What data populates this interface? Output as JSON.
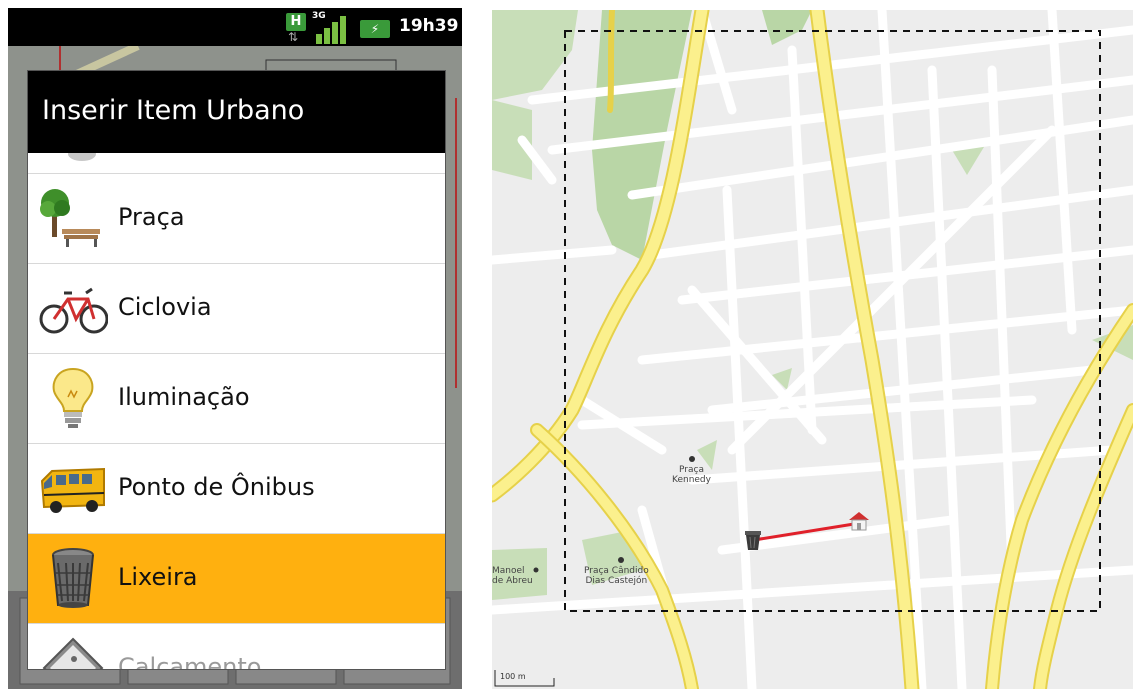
{
  "status_bar": {
    "network_h": "H",
    "network_3g": "3G",
    "time": "19h39"
  },
  "dialog": {
    "title": "Inserir Item Urbano",
    "items": [
      {
        "label": "Praça",
        "icon": "park-icon"
      },
      {
        "label": "Ciclovia",
        "icon": "bicycle-icon"
      },
      {
        "label": "Iluminação",
        "icon": "lightbulb-icon"
      },
      {
        "label": "Ponto de Ônibus",
        "icon": "bus-icon"
      },
      {
        "label": "Lixeira",
        "icon": "trash-bin-icon",
        "selected": true
      },
      {
        "label": "Calçamento",
        "icon": "pedestrian-sign-icon",
        "partial": true
      }
    ],
    "accent_color": "#ffb00f"
  },
  "map": {
    "labels": {
      "praca_kennedy_1": "Praça",
      "praca_kennedy_2": "Kennedy",
      "praca_candido_1": "Praça Cândido",
      "praca_candido_2": "Dias Castejón",
      "manoel_1": "Manoel",
      "manoel_2": "de Abreu"
    },
    "scale": "100 m",
    "route_color": "#e0202a"
  }
}
